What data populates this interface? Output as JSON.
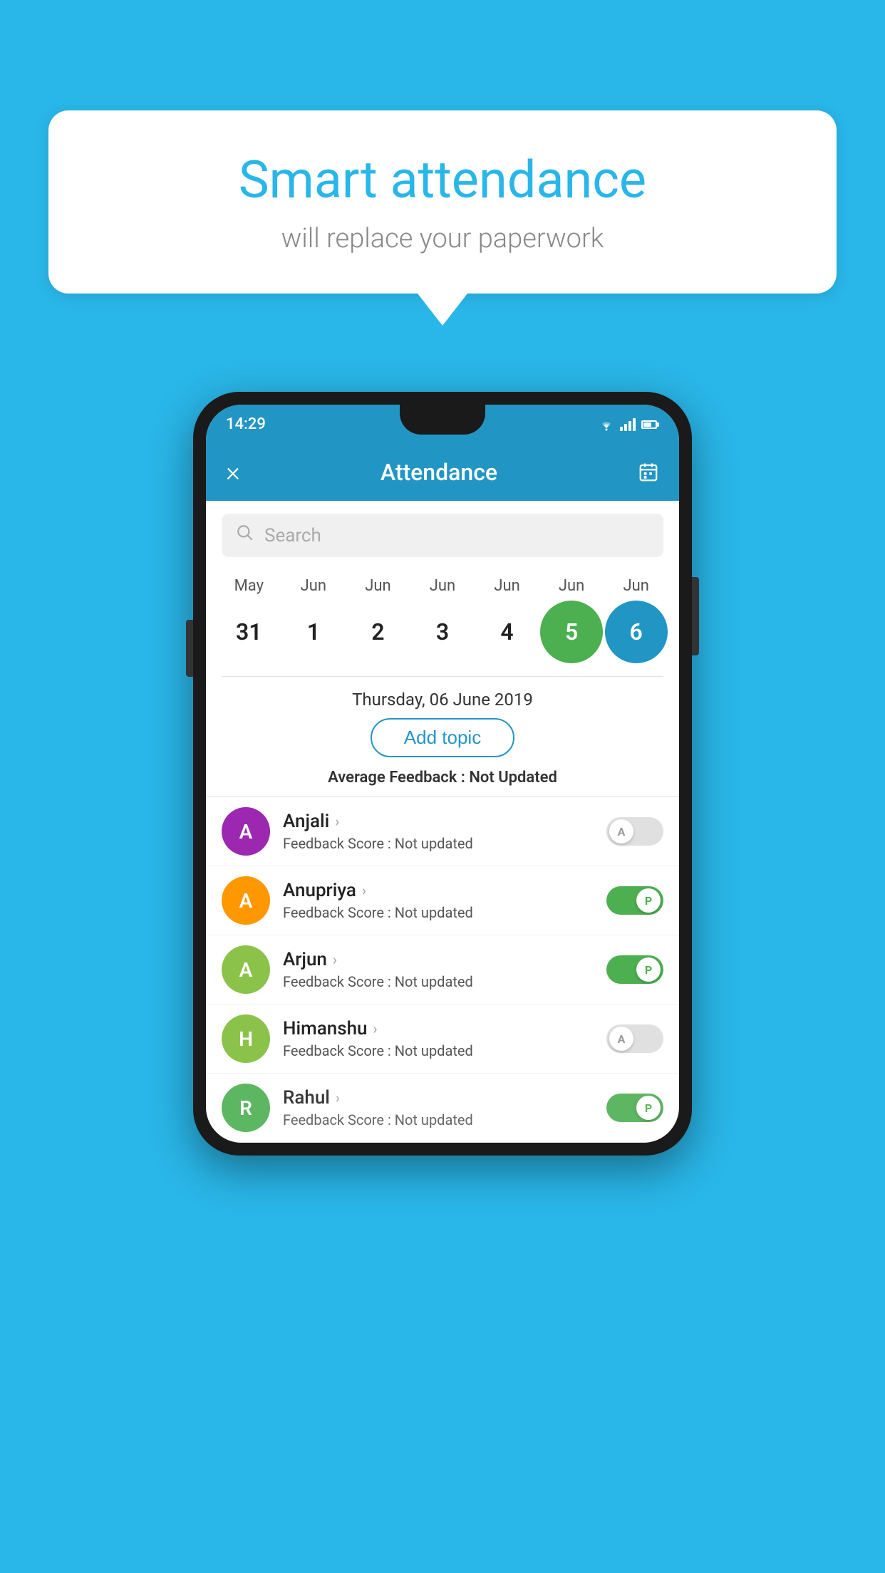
{
  "background_color": "#29b6e8",
  "speech_bubble": {
    "title": "Smart attendance",
    "subtitle": "will replace your paperwork"
  },
  "status_bar": {
    "time": "14:29"
  },
  "app_header": {
    "title": "Attendance",
    "close_label": "×",
    "calendar_label": "📅"
  },
  "search": {
    "placeholder": "Search"
  },
  "calendar": {
    "months": [
      "May",
      "Jun",
      "Jun",
      "Jun",
      "Jun",
      "Jun",
      "Jun"
    ],
    "dates": [
      "31",
      "1",
      "2",
      "3",
      "4",
      "5",
      "6"
    ],
    "selected_green_index": 4,
    "selected_blue_index": 5,
    "selected_date_label": "Thursday, 06 June 2019"
  },
  "add_topic": {
    "label": "Add topic"
  },
  "average_feedback": {
    "label": "Average Feedback :",
    "value": "Not Updated"
  },
  "students": [
    {
      "name": "Anjali",
      "avatar_letter": "A",
      "avatar_color": "#9c27b0",
      "feedback_label": "Feedback Score :",
      "feedback_value": "Not updated",
      "toggle_state": "off",
      "toggle_label": "A"
    },
    {
      "name": "Anupriya",
      "avatar_letter": "A",
      "avatar_color": "#ff9800",
      "feedback_label": "Feedback Score :",
      "feedback_value": "Not updated",
      "toggle_state": "on",
      "toggle_label": "P"
    },
    {
      "name": "Arjun",
      "avatar_letter": "A",
      "avatar_color": "#8bc34a",
      "feedback_label": "Feedback Score :",
      "feedback_value": "Not updated",
      "toggle_state": "on",
      "toggle_label": "P"
    },
    {
      "name": "Himanshu",
      "avatar_letter": "H",
      "avatar_color": "#8bc34a",
      "feedback_label": "Feedback Score :",
      "feedback_value": "Not updated",
      "toggle_state": "off",
      "toggle_label": "A"
    },
    {
      "name": "Rahul",
      "avatar_letter": "R",
      "avatar_color": "#4caf50",
      "feedback_label": "Feedback Score :",
      "feedback_value": "Not updated",
      "toggle_state": "on",
      "toggle_label": "P"
    }
  ]
}
